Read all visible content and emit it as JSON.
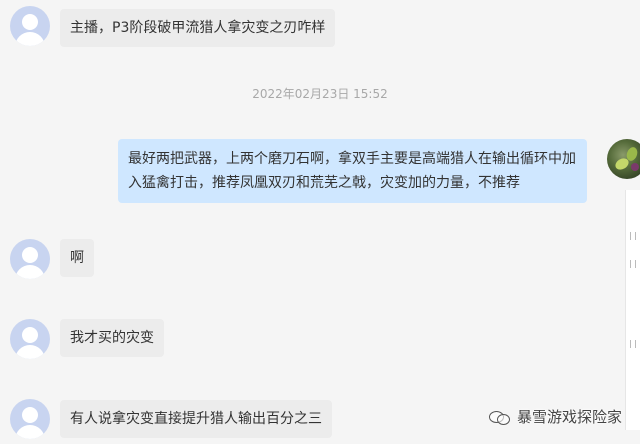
{
  "messages": [
    {
      "side": "left",
      "text": "主播，P3阶段破甲流猎人拿灾变之刃咋样"
    },
    {
      "side": "right",
      "text": "最好两把武器，上两个磨刀石啊，拿双手主要是高端猎人在输出循环中加入猛禽打击，推荐凤凰双刃和荒芜之戟，灾变加的力量，不推荐"
    },
    {
      "side": "left",
      "text": "啊"
    },
    {
      "side": "left",
      "text": "我才买的灾变"
    },
    {
      "side": "left",
      "text": "有人说拿灾变直接提升猎人输出百分之三"
    }
  ],
  "timestamp": "2022年02月23日 15:52",
  "watermark": {
    "icon": "wechat-icon",
    "text": "暴雪游戏探险家"
  },
  "colors": {
    "background": "#f5f5f5",
    "left_bubble": "#ececec",
    "right_bubble": "#cfe7ff",
    "timestamp": "#a8a8a8",
    "default_avatar": "#c8d4f0"
  }
}
